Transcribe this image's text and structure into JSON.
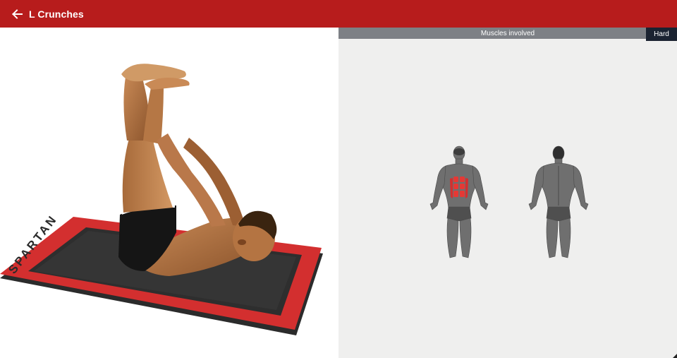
{
  "app_bar": {
    "title": "L Crunches",
    "background_color": "#b71c1c",
    "back_icon": "arrow-left-icon"
  },
  "exercise_image": {
    "mat_text": "SPARTAN",
    "mat_color": "#d32f2f"
  },
  "muscles_panel": {
    "header": "Muscles involved",
    "difficulty": "Hard",
    "highlight_color": "#e53935",
    "figures": [
      "front-body-figure",
      "back-body-figure"
    ]
  }
}
